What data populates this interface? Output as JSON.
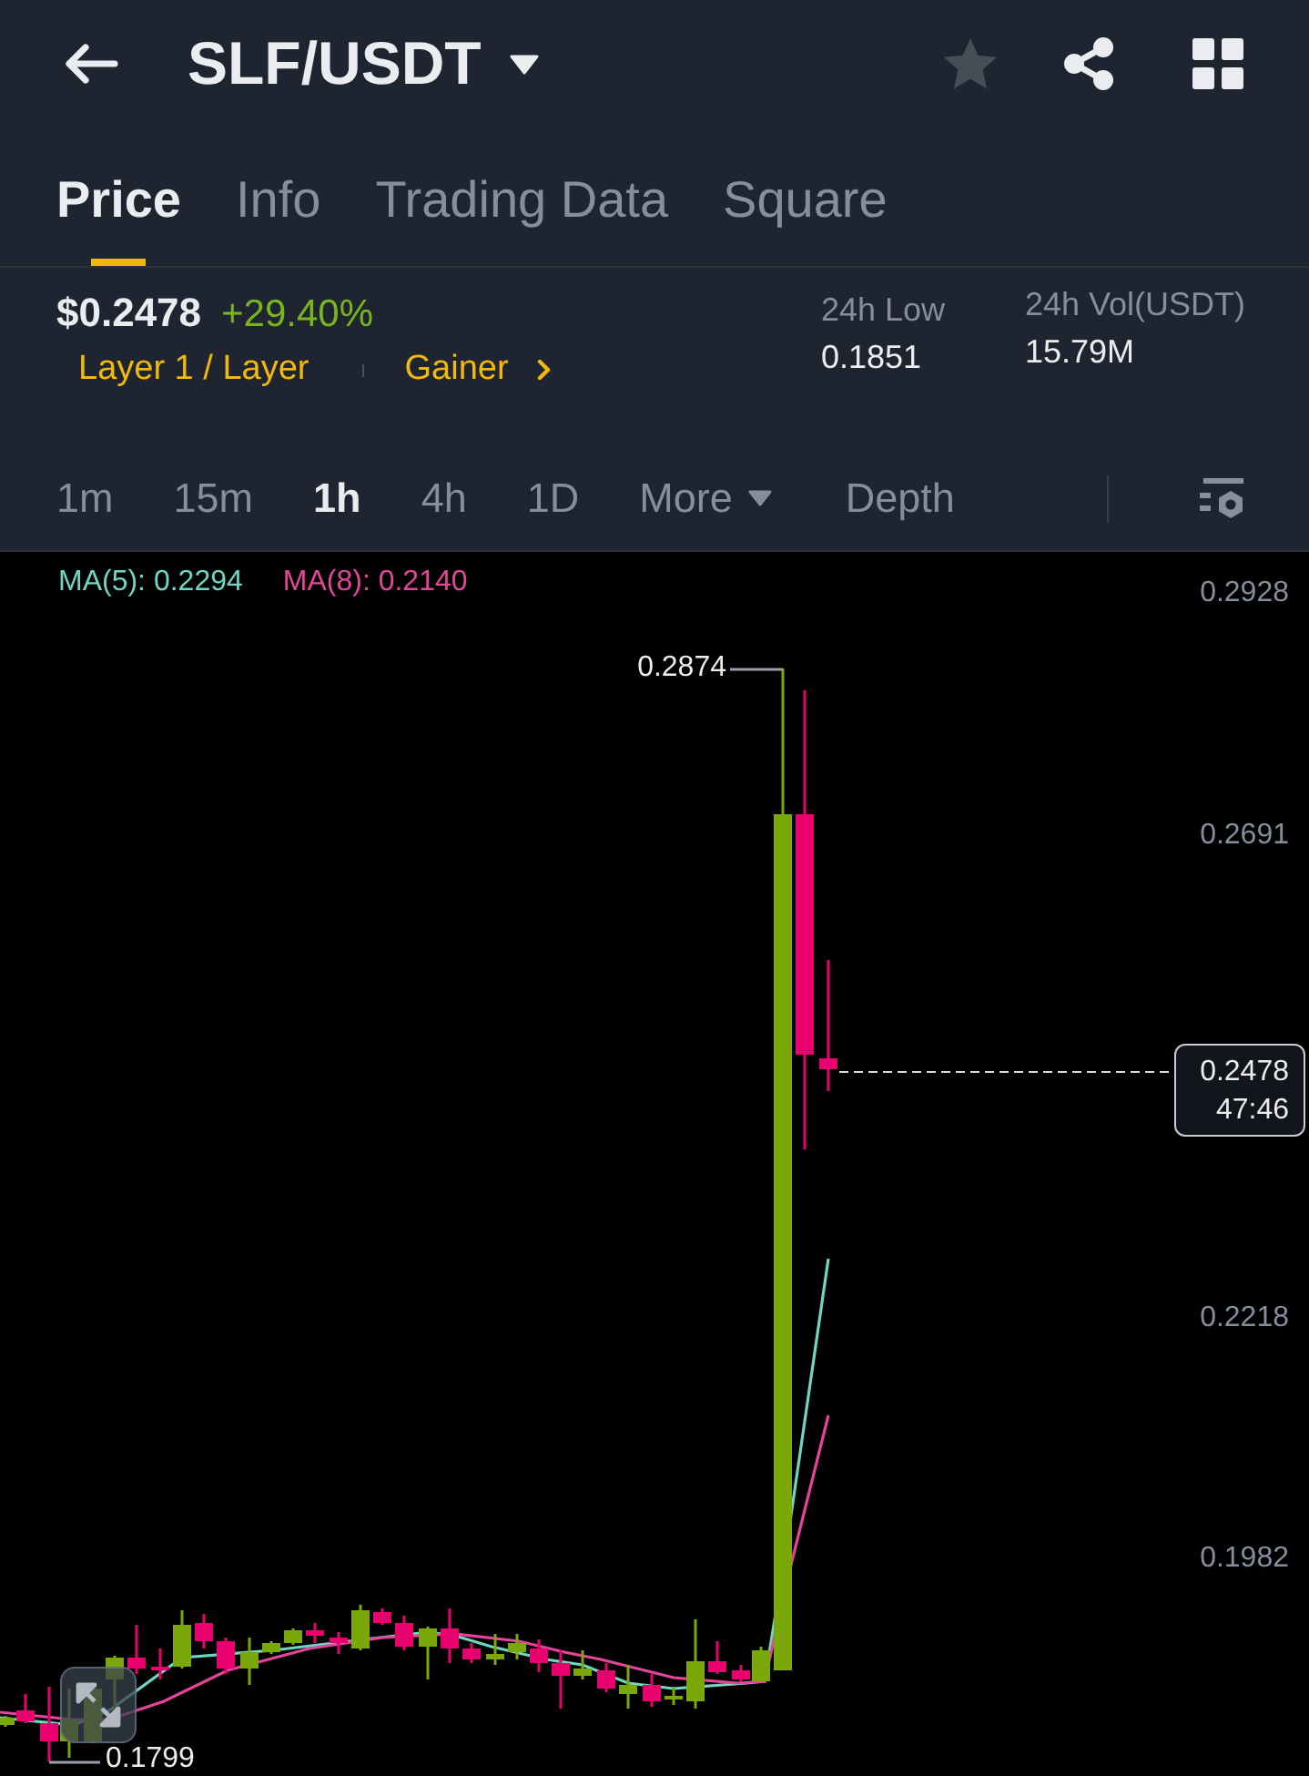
{
  "header": {
    "pair": "SLF/USDT",
    "favorite": false
  },
  "tabs": [
    {
      "label": "Price",
      "selected": true
    },
    {
      "label": "Info",
      "selected": false
    },
    {
      "label": "Trading Data",
      "selected": false
    },
    {
      "label": "Square",
      "selected": false
    }
  ],
  "ticker": {
    "price": "$0.2478",
    "change": "+29.40%",
    "rising": true,
    "tags": [
      {
        "label": "Layer 1 / Layer",
        "kind": "category"
      },
      {
        "label": "Gainer",
        "kind": "ranking"
      }
    ]
  },
  "stats": [
    {
      "label": "24h Low",
      "value": "0.1851"
    },
    {
      "label": "24h Vol(USDT)",
      "value": "15.79M"
    }
  ],
  "intervals": [
    {
      "label": "1m",
      "kind": "interval",
      "selected": false
    },
    {
      "label": "15m",
      "kind": "interval",
      "selected": false
    },
    {
      "label": "1h",
      "kind": "interval",
      "selected": true
    },
    {
      "label": "4h",
      "kind": "interval",
      "selected": false
    },
    {
      "label": "1D",
      "kind": "interval",
      "selected": false
    },
    {
      "label": "More",
      "kind": "menu",
      "selected": false
    },
    {
      "label": "Depth",
      "kind": "view",
      "selected": false
    }
  ],
  "chart": {
    "moving_averages": [
      {
        "label": "MA(5): 0.2294",
        "color": "#6fd6c3"
      },
      {
        "label": "MA(8): 0.2140",
        "color": "#e4449a"
      }
    ],
    "price_axis": [
      "0.2928",
      "0.2691",
      "0.2218",
      "0.1982"
    ],
    "high_label": "0.2874",
    "low_label": "0.1799",
    "last_price": {
      "price": "0.2478",
      "countdown": "47:46"
    }
  }
}
